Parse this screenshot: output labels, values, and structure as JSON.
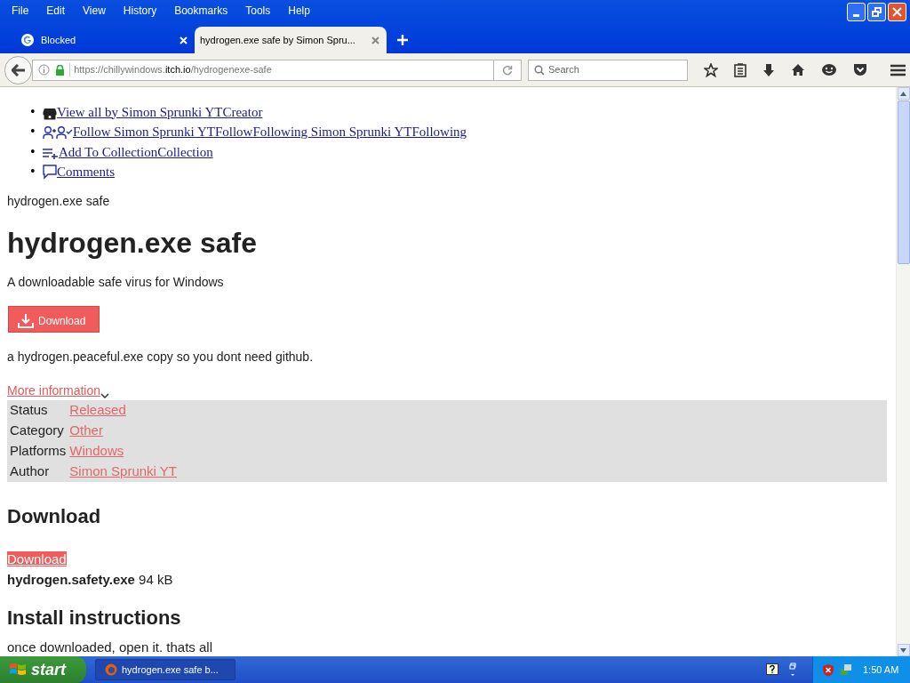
{
  "menu": [
    "File",
    "Edit",
    "View",
    "History",
    "Bookmarks",
    "Tools",
    "Help"
  ],
  "tabs": [
    {
      "kind": "google",
      "label": "Blocked",
      "selected": false
    },
    {
      "kind": "page",
      "label": "hydrogen.exe safe by Simon Spru...",
      "selected": true
    }
  ],
  "address": {
    "scheme": "https://chillywindows.",
    "domain": "itch.io",
    "path": "/hydrogenexe-safe"
  },
  "search": {
    "placeholder": "Search"
  },
  "page": {
    "nav_links": [
      {
        "kind": "creator",
        "marker": "•",
        "label": "View all by Simon Sprunki YTCreator"
      },
      {
        "kind": "follow",
        "marker": "•",
        "label": "Follow Simon Sprunki YTFollowFollowing Simon Sprunki YTFollowing"
      },
      {
        "kind": "collection",
        "marker": "•",
        "label": "Add To CollectionCollection"
      },
      {
        "kind": "comments",
        "marker": "•",
        "label": "Comments"
      }
    ],
    "breadcrumb": "hydrogen.exe safe",
    "title": "hydrogen.exe safe",
    "tagline": "A downloadable safe virus for Windows",
    "download_button": "Download",
    "description": "a hydrogen.peaceful.exe copy so you dont need github.",
    "more_info": "More information",
    "info_rows": [
      {
        "label": "Status",
        "value": "Released"
      },
      {
        "label": "Category",
        "value": "Other"
      },
      {
        "label": "Platforms",
        "value": "Windows"
      },
      {
        "label": "Author",
        "value": "Simon Sprunki YT"
      }
    ],
    "download_heading": "Download",
    "download_link": "Download",
    "file_name": "hydrogen.safety.exe",
    "file_size": "94 kB",
    "install_heading": "Install instructions",
    "install_text": "once downloaded, open it. thats all"
  },
  "taskbar": {
    "start": "start",
    "window": "hydrogen.exe safe b...",
    "clock": "1:50 AM"
  }
}
